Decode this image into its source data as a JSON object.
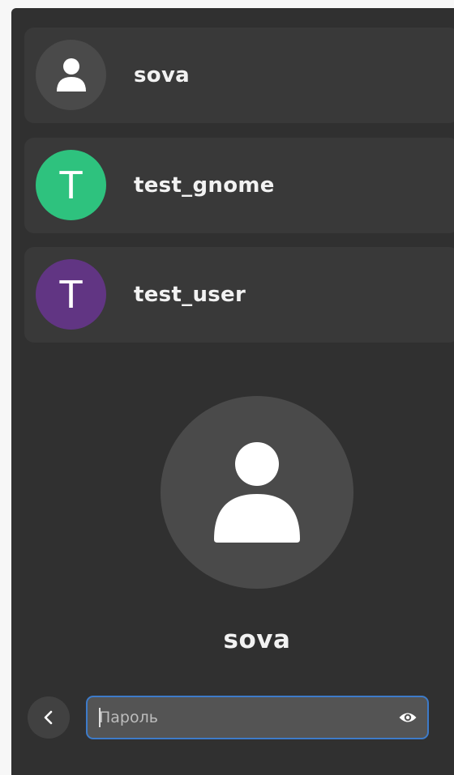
{
  "users": [
    {
      "name": "sova",
      "avatar_type": "default-icon",
      "avatar_letter": "",
      "avatar_color": "#4a4a4a"
    },
    {
      "name": "test_gnome",
      "avatar_type": "letter",
      "avatar_letter": "T",
      "avatar_color": "#2ec27e"
    },
    {
      "name": "test_user",
      "avatar_type": "letter",
      "avatar_letter": "T",
      "avatar_color": "#613583"
    }
  ],
  "selected_user": {
    "name": "sova",
    "avatar_icon": "person-icon"
  },
  "password": {
    "value": "",
    "placeholder": "Пароль",
    "reveal_icon": "eye-icon"
  },
  "back_icon": "chevron-left-icon",
  "colors": {
    "panel_bg": "#303030",
    "row_bg": "#393939",
    "focus_border": "#3d7bc9"
  }
}
